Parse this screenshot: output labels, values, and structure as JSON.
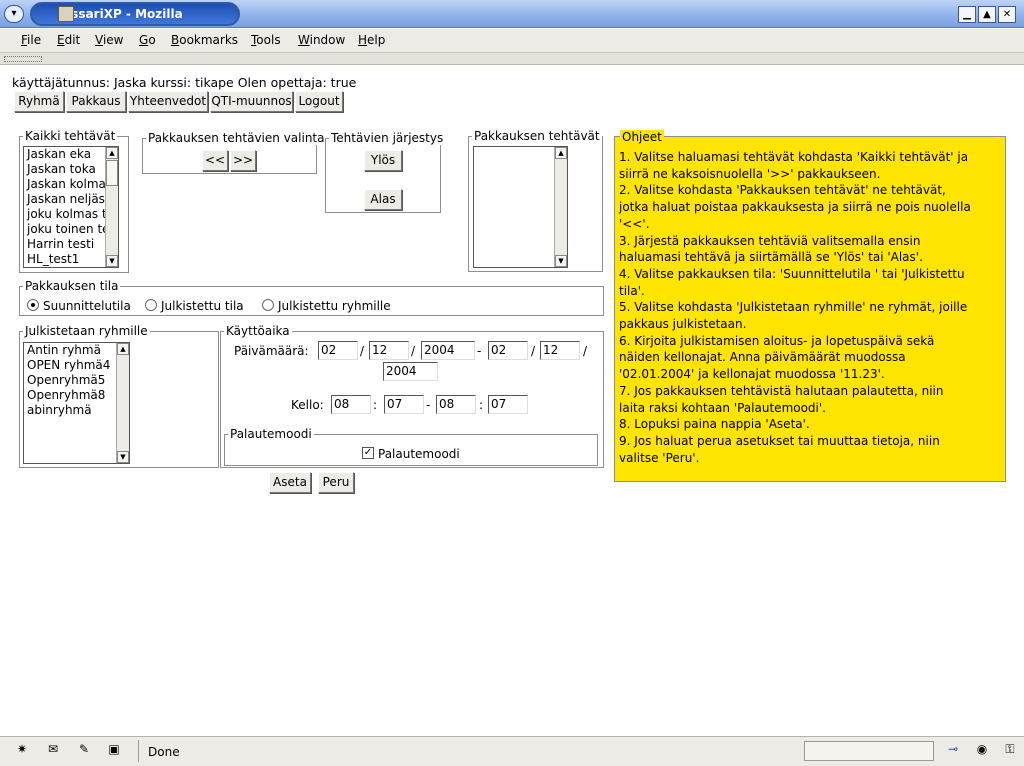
{
  "window": {
    "title": "AssariXP - Mozilla",
    "controls": [
      "minimize",
      "maximize",
      "close"
    ]
  },
  "menu": [
    {
      "label": "File",
      "key": "F"
    },
    {
      "label": "Edit",
      "key": "E"
    },
    {
      "label": "View",
      "key": "V"
    },
    {
      "label": "Go",
      "key": "G"
    },
    {
      "label": "Bookmarks",
      "key": "B"
    },
    {
      "label": "Tools",
      "key": "T"
    },
    {
      "label": "Window",
      "key": "W"
    },
    {
      "label": "Help",
      "key": "H"
    }
  ],
  "user_info": "käyttäjätunnus: Jaska kurssi: tikape Olen opettaja: true",
  "nav_buttons": [
    "Ryhmä",
    "Pakkaus",
    "Yhteenvedot",
    "QTI-muunnos",
    "Logout"
  ],
  "all_tasks": {
    "legend": "Kaikki tehtävät",
    "items": [
      "Jaskan eka",
      "Jaskan toka",
      "Jaskan kolmas",
      "Jaskan neljäs",
      "joku kolmas t",
      "joku toinen te",
      "Harrin testi",
      "HL_test1"
    ]
  },
  "selection": {
    "legend": "Pakkauksen tehtävien valinta",
    "remove_label": "<<",
    "add_label": ">>"
  },
  "order": {
    "legend": "Tehtävien järjestys",
    "up_label": "Ylös",
    "down_label": "Alas"
  },
  "package_tasks": {
    "legend": "Pakkauksen tehtävät",
    "items": []
  },
  "package_state": {
    "legend": "Pakkauksen tila",
    "options": [
      "Suunnittelutila",
      "Julkistettu tila",
      "Julkistettu ryhmille"
    ],
    "selected": "Suunnittelutila"
  },
  "groups": {
    "legend": "Julkistetaan ryhmille",
    "items": [
      "Antin ryhmä",
      "OPEN ryhmä4",
      "Openryhmä5",
      "Openryhmä8",
      "abinryhmä"
    ]
  },
  "usage": {
    "legend": "Käyttöaika",
    "date_label": "Päivämäärä:",
    "start_day": "02",
    "start_month": "12",
    "start_year": "2004",
    "end_day": "02",
    "end_month": "12",
    "end_year": "2004",
    "date_sep": "/",
    "range_sep": "-",
    "time_label": "Kello:",
    "start_hour": "08",
    "start_minute": "07",
    "end_hour": "08",
    "end_minute": "07",
    "time_sep": ":"
  },
  "feedback": {
    "legend": "Palautemoodi",
    "checkbox_label": "Palautemoodi",
    "checked": true
  },
  "actions": {
    "set_label": "Aseta",
    "cancel_label": "Peru"
  },
  "help": {
    "legend": "Ohjeet",
    "lines": [
      "1. Valitse haluamasi tehtävät kohdasta 'Kaikki tehtävät' ja",
      "siirrä ne kaksoisnuolella '>>' pakkaukseen.",
      "2. Valitse kohdasta 'Pakkauksen tehtävät' ne tehtävät,",
      "jotka haluat poistaa pakkauksesta ja siirrä ne pois nuolella",
      "'<<'.",
      "3. Järjestä pakkauksen tehtäviä valitsemalla ensin",
      "haluamasi tehtävä ja siirtämällä se 'Ylös' tai 'Alas'.",
      "4. Valitse pakkauksen tila: 'Suunnittelutila ' tai 'Julkistettu",
      "tila'.",
      "5. Valitse kohdasta 'Julkistetaan ryhmille' ne ryhmät, joille",
      "pakkaus julkistetaan.",
      "6. Kirjoita julkistamisen aloitus- ja lopetuspäivä sekä",
      "näiden kellonajat. Anna päivämäärät muodossa",
      "'02.01.2004' ja kellonajat muodossa '11.23'.",
      "7. Jos pakkauksen tehtävistä halutaan palautetta, niin",
      "laita raksi kohtaan 'Palautemoodi'.",
      "8. Lopuksi paina nappia 'Aseta'.",
      "9. Jos haluat perua asetukset tai muuttaa tietoja, niin",
      "valitse 'Peru'."
    ],
    "background": "#ffe400"
  },
  "status": {
    "text": "Done",
    "icons": [
      "navigator-icon",
      "mail-icon",
      "composer-icon",
      "address-book-icon"
    ],
    "right_icons": [
      "online-plug-icon",
      "security-icon",
      "lock-icon"
    ]
  }
}
